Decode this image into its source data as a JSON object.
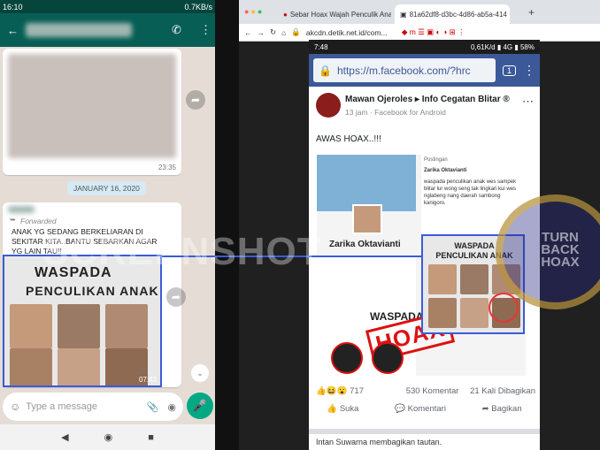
{
  "left_phone": {
    "status_time": "16:10",
    "status_net": "0.7KB/s",
    "time1": "23:35",
    "date_chip": "JANUARY 16, 2020",
    "forwarded": "Forwarded",
    "msg_text": "ANAK YG SEDANG BERKELIARAN DI SEKITAR KITA..BANTU SEBARKAN AGAR YG LAIN TAU!!",
    "image_title1": "WASPADA",
    "image_title2": "PENCULIKAN ANAK",
    "time2": "07:43",
    "input_placeholder": "Type a message"
  },
  "browser": {
    "tab1": "Sebar Hoax Wajah Penculik Anak",
    "tab2": "81a62df8-d3bc-4d86-ab5a-414",
    "url": "akcdn.detik.net.id/com..."
  },
  "fb": {
    "status_time": "7:48",
    "status_right": "0,61K/d",
    "battery": "58%",
    "url": "https://m.facebook.com/?hrc",
    "tab_count": "1",
    "author": "Mawan Ojeroles",
    "group": "Info Cegatan Blitar ®",
    "meta": "13 jam · Facebook for Android",
    "post_text": "AWAS HOAX..!!!",
    "shared_label": "Postingan",
    "shared_author": "Zarika Oktavianti",
    "shared_text": "waspada penculikan anak wes sampek blitar lur wong seng tak lingkari kui wes nglabeng nang daerah sambong kanigoro.",
    "profile_name": "Zarika Oktavianti",
    "waspada": "WASPADA",
    "poster_title": "WASPADA PENCULIKAN ANAK",
    "stamp": "HOAX",
    "reactions": "717",
    "comments": "530 Komentar",
    "shares": "21 Kali Dibagikan",
    "like": "Suka",
    "comment": "Komentari",
    "share": "Bagikan",
    "next_author": "Intan Suwarna membagikan tautan."
  },
  "watermark": "SCREENSHOT",
  "badge": "TURN BACK HOAX"
}
